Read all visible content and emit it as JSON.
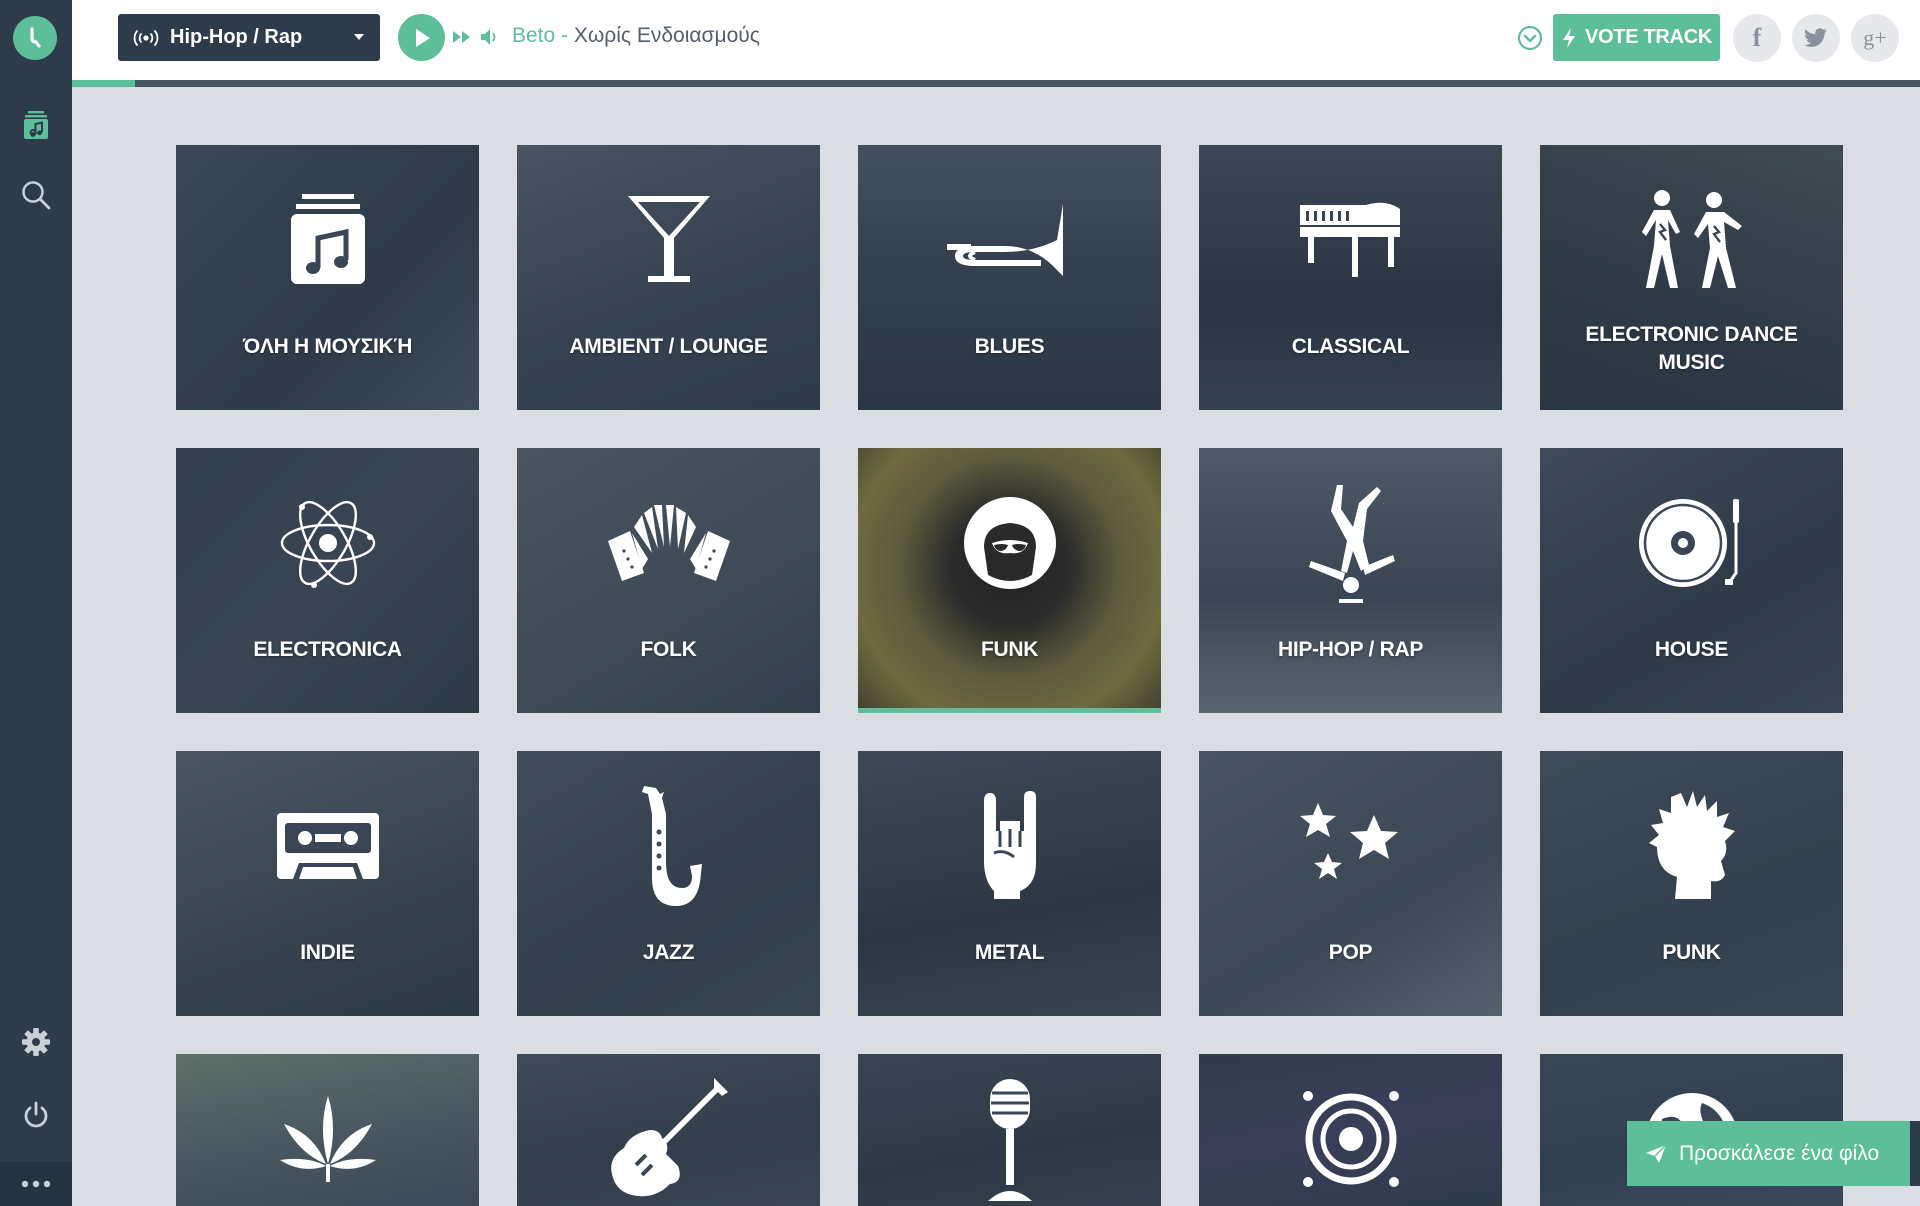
{
  "header": {
    "station_label": "Hip-Hop / Rap",
    "artist": "Beto",
    "separator": " - ",
    "track": "Χωρίς Ενδοιασμούς",
    "vote_label": "VOTE TRACK",
    "progress_fraction": 0.034
  },
  "social": {
    "facebook": "f",
    "googleplus": "g+"
  },
  "genres": [
    {
      "label": "ΌΛΗ Η ΜΟΥΣΙΚΉ",
      "icon": "music-note-icon"
    },
    {
      "label": "AMBIENT / LOUNGE",
      "icon": "cocktail-icon"
    },
    {
      "label": "BLUES",
      "icon": "trumpet-icon"
    },
    {
      "label": "CLASSICAL",
      "icon": "piano-icon"
    },
    {
      "label": "ELECTRONIC DANCE MUSIC",
      "icon": "dancers-icon"
    },
    {
      "label": "ELECTRONICA",
      "icon": "atom-icon"
    },
    {
      "label": "FOLK",
      "icon": "accordion-icon"
    },
    {
      "label": "FUNK",
      "icon": "afro-icon"
    },
    {
      "label": "HIP-HOP / RAP",
      "icon": "breakdancer-icon"
    },
    {
      "label": "HOUSE",
      "icon": "turntable-icon"
    },
    {
      "label": "INDIE",
      "icon": "cassette-icon"
    },
    {
      "label": "JAZZ",
      "icon": "saxophone-icon"
    },
    {
      "label": "METAL",
      "icon": "horns-hand-icon"
    },
    {
      "label": "POP",
      "icon": "stars-icon"
    },
    {
      "label": "PUNK",
      "icon": "mohawk-icon"
    }
  ],
  "partial_row_icons": [
    "leaf-icon",
    "guitar-icon",
    "microphone-icon",
    "speaker-icon",
    "globe-icon"
  ],
  "invite_label": "Προσκάλεσε ένα φίλο",
  "colors": {
    "accent": "#5cbf9a",
    "sidebar": "#2e3b4b",
    "page_bg": "#dadde1"
  }
}
